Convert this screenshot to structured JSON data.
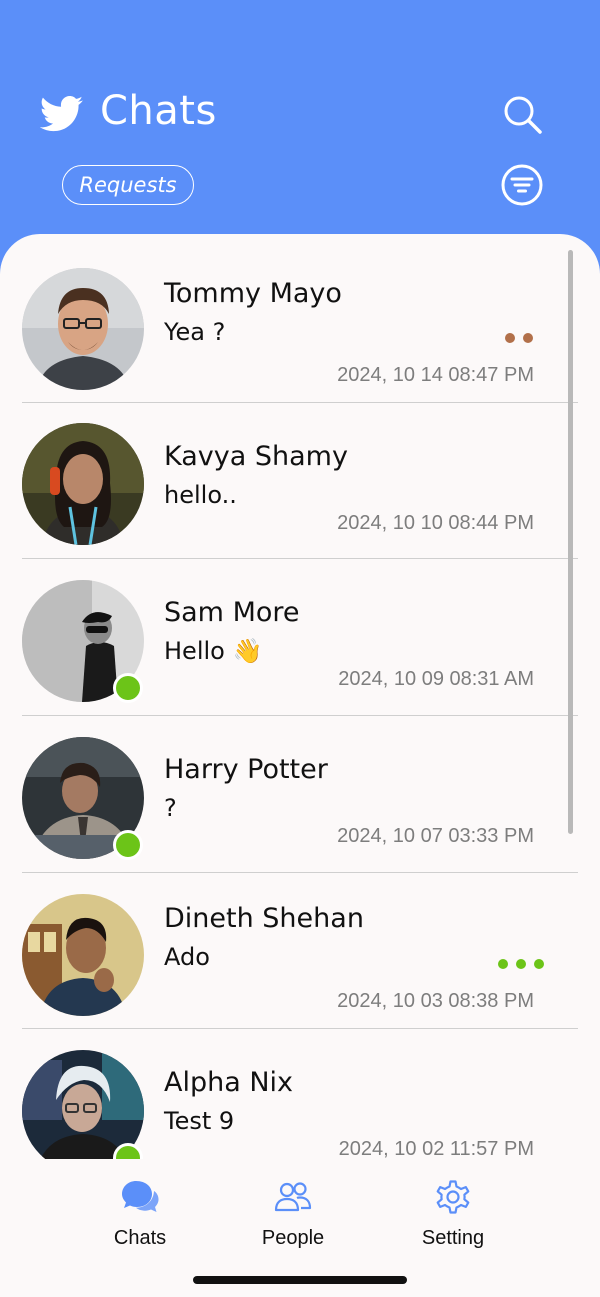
{
  "header": {
    "title": "Chats",
    "requests_label": "Requests",
    "logo_icon": "bird-logo-icon",
    "search_icon": "search-icon",
    "filter_icon": "filter-icon"
  },
  "chats": [
    {
      "name": "Tommy Mayo",
      "message": "Yea ?",
      "time": "2024, 10 14 08:47 PM",
      "online": false,
      "typing": "brown-dots"
    },
    {
      "name": "Kavya Shamy",
      "message": "hello..",
      "time": "2024, 10 10 08:44 PM",
      "online": false
    },
    {
      "name": "Sam More",
      "message": "Hello 👋",
      "time": "2024, 10 09 08:31 AM",
      "online": true
    },
    {
      "name": "Harry Potter",
      "message": "?",
      "time": "2024, 10 07 03:33 PM",
      "online": true
    },
    {
      "name": "Dineth Shehan",
      "message": "Ado",
      "time": "2024, 10 03 08:38 PM",
      "online": false,
      "typing": "green-dots"
    },
    {
      "name": "Alpha Nix",
      "message": "Test 9",
      "time": "2024, 10 02 11:57 PM",
      "online": true
    }
  ],
  "nav": [
    {
      "label": "Chats",
      "icon": "chat-bubbles-icon",
      "active": true
    },
    {
      "label": "People",
      "icon": "people-icon",
      "active": false
    },
    {
      "label": "Setting",
      "icon": "gear-icon",
      "active": false
    }
  ],
  "colors": {
    "header_bg": "#5b8ff9",
    "sheet_bg": "#fcf9f9",
    "online": "#6cc418",
    "typing_brown": "#b2704a",
    "typing_green": "#6cc418",
    "nav_icon": "#5b8ff9"
  }
}
